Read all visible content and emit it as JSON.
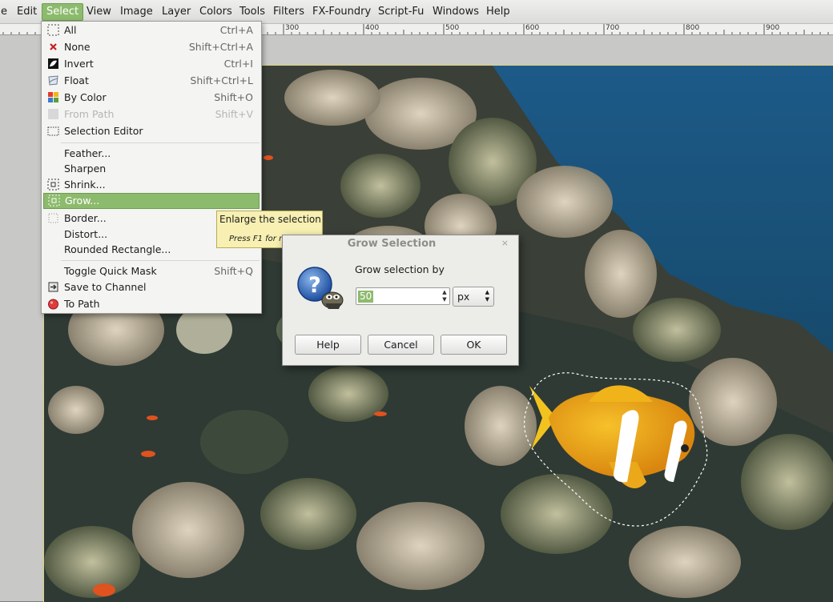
{
  "menubar": {
    "items": [
      {
        "label": "e"
      },
      {
        "label": "Edit"
      },
      {
        "label": "Select"
      },
      {
        "label": "View"
      },
      {
        "label": "Image"
      },
      {
        "label": "Layer"
      },
      {
        "label": "Colors"
      },
      {
        "label": "Tools"
      },
      {
        "label": "Filters"
      },
      {
        "label": "FX-Foundry"
      },
      {
        "label": "Script-Fu"
      },
      {
        "label": "Windows"
      },
      {
        "label": "Help"
      }
    ]
  },
  "ruler": {
    "labels": [
      "300",
      "400",
      "500",
      "600",
      "700",
      "800",
      "900"
    ]
  },
  "select_menu": {
    "items": [
      {
        "label": "All",
        "shortcut": "Ctrl+A",
        "icon": "select-all-icon"
      },
      {
        "label": "None",
        "shortcut": "Shift+Ctrl+A",
        "icon": "select-none-icon"
      },
      {
        "label": "Invert",
        "shortcut": "Ctrl+I",
        "icon": "invert-selection-icon"
      },
      {
        "label": "Float",
        "shortcut": "Shift+Ctrl+L",
        "icon": "float-selection-icon"
      },
      {
        "label": "By Color",
        "shortcut": "Shift+O",
        "icon": "by-color-select-icon"
      },
      {
        "label": "From Path",
        "shortcut": "Shift+V",
        "icon": "from-path-icon",
        "disabled": true
      },
      {
        "label": "Selection Editor",
        "shortcut": "",
        "icon": "selection-editor-icon"
      },
      {
        "label": "Feather...",
        "shortcut": ""
      },
      {
        "label": "Sharpen",
        "shortcut": ""
      },
      {
        "label": "Shrink...",
        "shortcut": "",
        "icon": "shrink-selection-icon"
      },
      {
        "label": "Grow...",
        "shortcut": "",
        "icon": "grow-selection-icon",
        "highlighted": true
      },
      {
        "label": "Border...",
        "shortcut": "",
        "icon": "border-selection-icon"
      },
      {
        "label": "Distort...",
        "shortcut": ""
      },
      {
        "label": "Rounded Rectangle...",
        "shortcut": ""
      },
      {
        "label": "Toggle Quick Mask",
        "shortcut": "Shift+Q"
      },
      {
        "label": "Save to Channel",
        "shortcut": "",
        "icon": "save-to-channel-icon"
      },
      {
        "label": "To Path",
        "shortcut": "",
        "icon": "to-path-icon"
      }
    ]
  },
  "tooltip": {
    "text": "Enlarge the selection",
    "help": "Press F1 for more help"
  },
  "dialog": {
    "title": "Grow Selection",
    "close": "×",
    "prompt": "Grow selection by",
    "value": "50",
    "unit": "px",
    "buttons": {
      "help": "Help",
      "cancel": "Cancel",
      "ok": "OK"
    }
  },
  "colors": {
    "highlight": "#8dbb6d",
    "tooltip_bg": "#f7f0b2",
    "canvas_bg": "#c8c8c6"
  }
}
